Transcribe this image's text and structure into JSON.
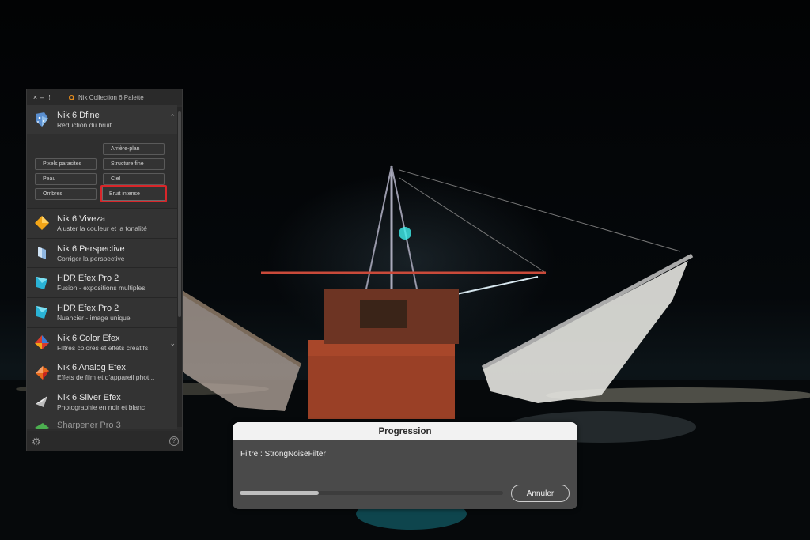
{
  "palette": {
    "title": "Nik Collection 6 Palette",
    "controls": {
      "close": "×",
      "minimize": "–",
      "more": "⁝"
    },
    "expanded": {
      "name": "Nik 6 Dfine",
      "sub": "Réduction du bruit",
      "icon": "dfine-icon",
      "presets": [
        "Arrière-plan",
        "Pixels parasites",
        "Structure fine",
        "Peau",
        "Ciel",
        "Ombres",
        "Bruit intense"
      ],
      "selected_preset": "Bruit intense"
    },
    "items": [
      {
        "name": "Nik 6 Viveza",
        "sub": "Ajuster la couleur et la tonalité",
        "icon": "viveza-icon",
        "color": "#f2a517"
      },
      {
        "name": "Nik 6 Perspective",
        "sub": "Corriger la perspective",
        "icon": "perspective-icon",
        "color": "#8fb6e0"
      },
      {
        "name": "HDR Efex Pro 2",
        "sub": "Fusion - expositions multiples",
        "icon": "hdr-efex-icon",
        "color": "#2ab3d6"
      },
      {
        "name": "HDR Efex Pro 2",
        "sub": "Nuancier - image unique",
        "icon": "hdr-efex-icon",
        "color": "#2ab3d6"
      },
      {
        "name": "Nik 6 Color Efex",
        "sub": "Filtres colorés et effets créatifs",
        "icon": "color-efex-icon",
        "color": "#d83b2e"
      },
      {
        "name": "Nik 6 Analog Efex",
        "sub": "Effets de film et d'appareil phot...",
        "icon": "analog-efex-icon",
        "color": "#e86a1c"
      },
      {
        "name": "Nik 6 Silver Efex",
        "sub": "Photographie en noir et blanc",
        "icon": "silver-efex-icon",
        "color": "#bdbdbd"
      },
      {
        "name": "Sharpener Pro 3",
        "sub": "",
        "icon": "sharpener-icon",
        "color": "#4caf50"
      }
    ],
    "footer": {
      "settings": "settings-icon",
      "help": "?"
    }
  },
  "dialog": {
    "title": "Progression",
    "filter_text": "Filtre : StrongNoiseFilter",
    "progress": 0.3,
    "cancel_label": "Annuler"
  }
}
